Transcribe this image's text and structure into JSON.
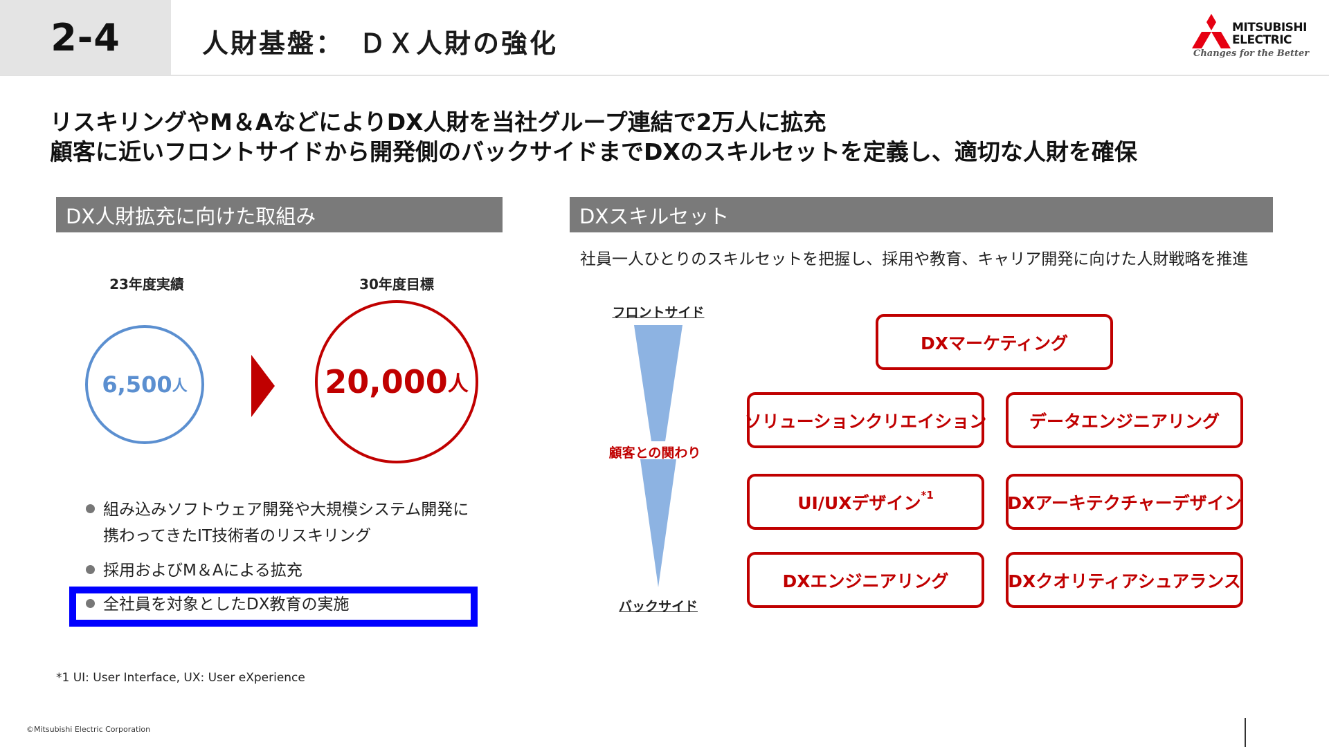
{
  "header": {
    "section_number": "2-4",
    "title": "人財基盤：　ＤＸ人財の強化"
  },
  "logo": {
    "word1": "MITSUBISHI",
    "word2": "ELECTRIC",
    "tagline": "Changes for the Better"
  },
  "headline": {
    "line1": "リスキリングやM＆AなどによりDX人財を当社グループ連結で2万人に拡充",
    "line2": "顧客に近いフロントサイドから開発側のバックサイドまでDXのスキルセットを定義し、適切な人財を確保"
  },
  "left_panel": {
    "title": "DX人財拡充に向けた取組み",
    "current": {
      "label": "23年度実績",
      "number": "6,500",
      "unit": "人"
    },
    "target": {
      "label": "30年度目標",
      "number": "20,000",
      "unit": "人"
    },
    "bullets": [
      {
        "line1": "組み込みソフトウェア開発や大規模システム開発に",
        "line2": "携わってきたIT技術者のリスキリング"
      },
      {
        "line1": "採用およびM＆Aによる拡充"
      },
      {
        "line1": "全社員を対象としたDX教育の実施"
      }
    ]
  },
  "right_panel": {
    "title": "DXスキルセット",
    "subtitle": "社員一人ひとりのスキルセットを把握し、採用や教育、キャリア開発に向けた人財戦略を推進",
    "axis": {
      "front": "フロントサイド",
      "customer": "顧客との関わり",
      "back": "バックサイド"
    },
    "skills": {
      "marketing": "DXマーケティング",
      "solution": "ソリューションクリエイション",
      "data": "データエンジニアリング",
      "uiux": "UI/UXデザイン",
      "uiux_note": "*1",
      "architecture": "DXアーキテクチャーデザイン",
      "engineering": "DXエンジニアリング",
      "quality": "DXクオリティアシュアランス"
    }
  },
  "footnote": "*1 UI: User Interface, UX: User eXperience",
  "copyright": "©Mitsubishi Electric Corporation",
  "colors": {
    "accent_red": "#c00000",
    "accent_blue": "#5b8fd0",
    "panel_gray": "#7a7a7a",
    "highlight_blue": "#0000ff"
  }
}
